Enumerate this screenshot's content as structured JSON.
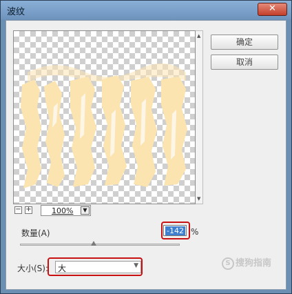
{
  "window": {
    "title": "波纹",
    "close_glyph": "✕"
  },
  "buttons": {
    "ok_label": "确定",
    "cancel_label": "取消"
  },
  "preview": {
    "zoom_value": "100%",
    "zoom_out_glyph": "−",
    "zoom_in_glyph": "+",
    "dropdown_glyph": "▼"
  },
  "amount": {
    "label": "数量(A)",
    "value": "-142",
    "unit": "%",
    "slider_level_percent": 46
  },
  "size": {
    "label": "大小(S):",
    "selected": "大"
  },
  "watermark": {
    "icon_glyph": "S",
    "text": "搜狗指南"
  },
  "colors": {
    "ripple_fill": "#fbe4b0",
    "accent_red": "#c81010",
    "selection_blue": "#3e7fd0"
  }
}
